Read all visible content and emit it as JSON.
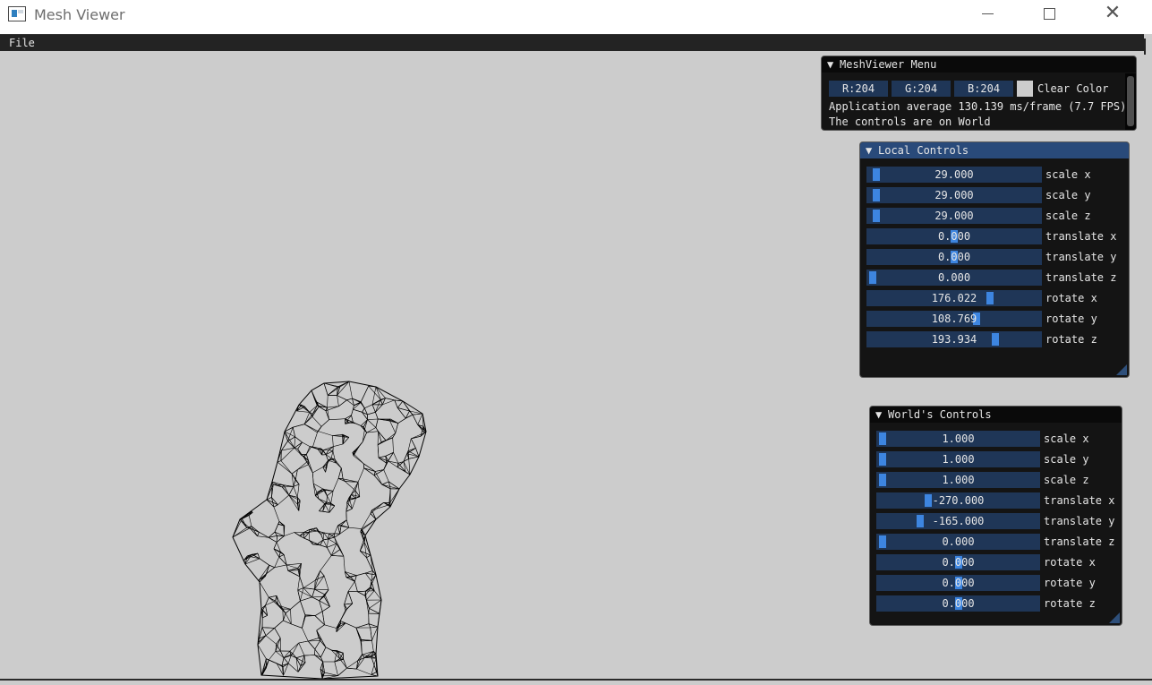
{
  "window": {
    "title": "Mesh Viewer"
  },
  "menubar": {
    "file": "File"
  },
  "meshviewer_menu": {
    "title": "MeshViewer Menu",
    "r": "R:204",
    "g": "G:204",
    "b": "B:204",
    "clear_color_label": "Clear Color",
    "clear_color": "#cccccc",
    "fps_text": "Application average 130.139 ms/frame (7.7 FPS)",
    "controls_text": "The controls are on World"
  },
  "local_controls": {
    "title": "Local Controls",
    "sliders": [
      {
        "value": "29.000",
        "label": "scale x",
        "level": 0.02
      },
      {
        "value": "29.000",
        "label": "scale y",
        "level": 0.02
      },
      {
        "value": "29.000",
        "label": "scale z",
        "level": 0.02
      },
      {
        "value": "0.000",
        "label": "translate x",
        "level": 0.5
      },
      {
        "value": "0.000",
        "label": "translate y",
        "level": 0.5
      },
      {
        "value": "0.000",
        "label": "translate z",
        "level": 0.0
      },
      {
        "value": "176.022",
        "label": "rotate x",
        "level": 0.72
      },
      {
        "value": "108.769",
        "label": "rotate y",
        "level": 0.64
      },
      {
        "value": "193.934",
        "label": "rotate z",
        "level": 0.75
      }
    ]
  },
  "world_controls": {
    "title": "World's Controls",
    "sliders": [
      {
        "value": "1.000",
        "label": "scale x",
        "level": 0.0
      },
      {
        "value": "1.000",
        "label": "scale y",
        "level": 0.0
      },
      {
        "value": "1.000",
        "label": "scale z",
        "level": 0.0
      },
      {
        "value": "-270.000",
        "label": "translate x",
        "level": 0.3
      },
      {
        "value": "-165.000",
        "label": "translate y",
        "level": 0.25
      },
      {
        "value": "0.000",
        "label": "translate z",
        "level": 0.0
      },
      {
        "value": "0.000",
        "label": "rotate x",
        "level": 0.5
      },
      {
        "value": "0.000",
        "label": "rotate y",
        "level": 0.5
      },
      {
        "value": "0.000",
        "label": "rotate z",
        "level": 0.5
      }
    ]
  },
  "viewport": {
    "content": "wireframe-bust-mesh"
  },
  "colors": {
    "accent": "#3d85e0",
    "widget": "#1f3657",
    "header_active": "#294a7a",
    "background": "#cccccc"
  }
}
